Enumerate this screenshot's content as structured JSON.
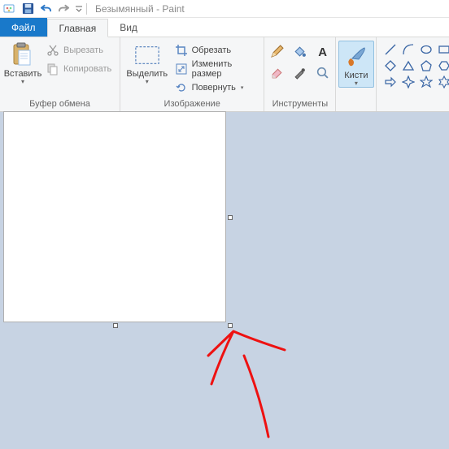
{
  "title": {
    "app": "Paint",
    "doc": "Безымянный",
    "full": "Безымянный - Paint"
  },
  "tabs": {
    "file": "Файл",
    "home": "Главная",
    "view": "Вид"
  },
  "clipboard": {
    "label": "Буфер обмена",
    "paste": "Вставить",
    "cut": "Вырезать",
    "copy": "Копировать"
  },
  "image": {
    "label": "Изображение",
    "select": "Выделить",
    "crop": "Обрезать",
    "resize": "Изменить размер",
    "rotate": "Повернуть"
  },
  "tools": {
    "label": "Инструменты"
  },
  "brushes": {
    "label": "Кисти"
  }
}
